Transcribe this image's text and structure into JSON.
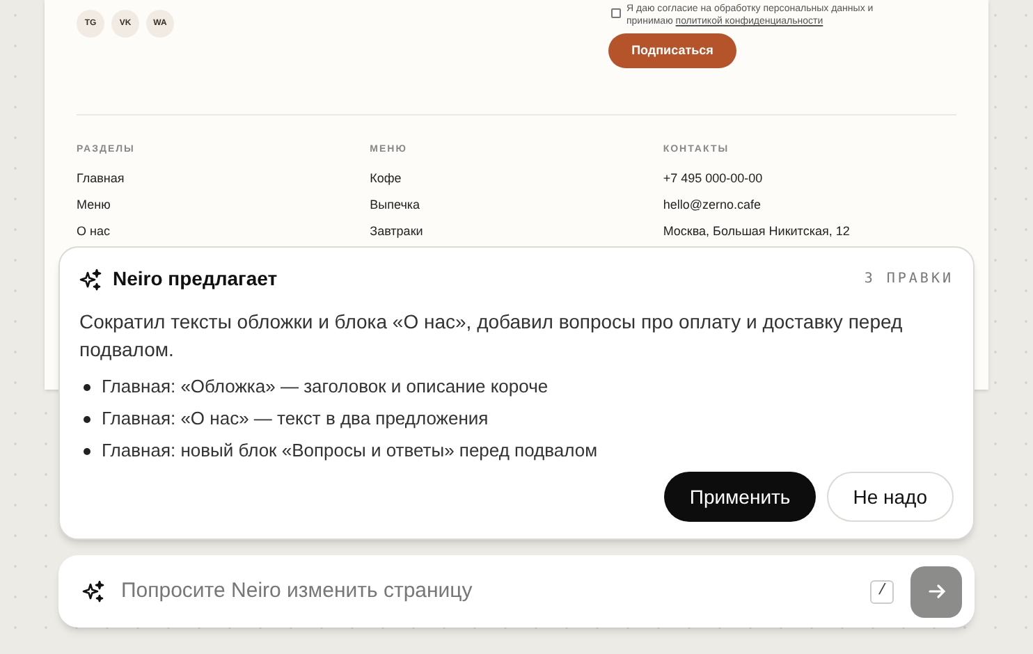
{
  "footer": {
    "socials": [
      "TG",
      "VK",
      "WA"
    ],
    "consent": {
      "checked": false,
      "text": "Я даю согласие на обработку персональных данных и принимаю",
      "link": "политикой конфиденциальности"
    },
    "subscribe_button": "Подписаться",
    "columns": [
      {
        "heading": "РАЗДЕЛЫ",
        "items": [
          "Главная",
          "Меню",
          "О нас"
        ]
      },
      {
        "heading": "МЕНЮ",
        "items": [
          "Кофе",
          "Выпечка",
          "Завтраки"
        ]
      },
      {
        "heading": "КОНТАКТЫ",
        "items": [
          "+7 495 000-00-00",
          "hello@zerno.cafe",
          "Москва, Большая Никитская, 12"
        ]
      }
    ]
  },
  "suggestion": {
    "title": "Neiro предлагает",
    "count": "3 ПРАВКИ",
    "summary": "Сократил тексты обложки и блока «О нас», добавил вопросы про оплату и доставку перед подвалом.",
    "changes": [
      "Главная: «Обложка» — заголовок и описание короче",
      "Главная: «О нас» — текст в два предложения",
      "Главная: новый блок «Вопросы и ответы» перед подвалом"
    ],
    "apply_button": "Применить",
    "dismiss_button": "Не надо"
  },
  "prompt": {
    "placeholder": "Попросите Neiro изменить страницу",
    "shortcut": "/",
    "send_disabled": true
  }
}
